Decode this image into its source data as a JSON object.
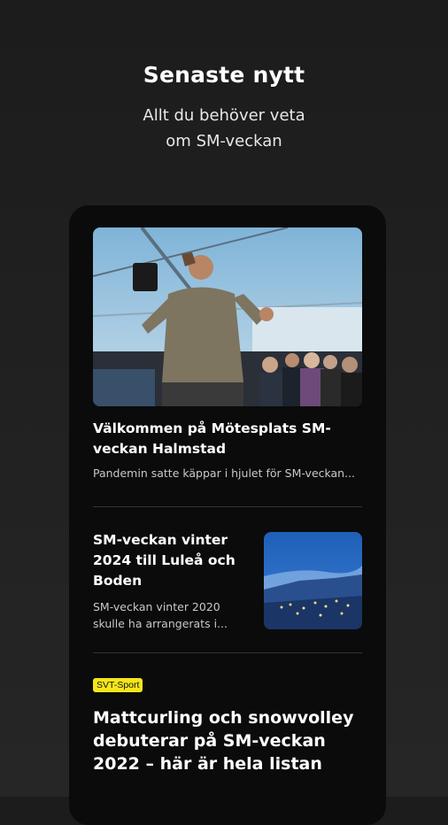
{
  "promo": {
    "title": "Senaste nytt",
    "subtitle": "Allt du behöver veta\nom SM-veckan"
  },
  "feed": {
    "hero": {
      "image_alt": "Man talar i ett tält inför publik",
      "title": "Välkommen på Mötesplats SM-veckan Halmstad",
      "description": "Pandemin satte käppar i hjulet för SM-veckan..."
    },
    "item2": {
      "title": "SM-veckan vinter 2024 till Luleå och Boden",
      "description": "SM-veckan vinter 2020 skulle ha arrangerats i..."
    },
    "item3": {
      "badge": "SVT-Sport",
      "title": "Mattcurling och snowvolley debuterar på SM-veckan 2022 – här är hela listan"
    }
  },
  "colors": {
    "background": "#1f1f1f",
    "card": "#0b0b0b",
    "badge": "#f5e61a"
  }
}
